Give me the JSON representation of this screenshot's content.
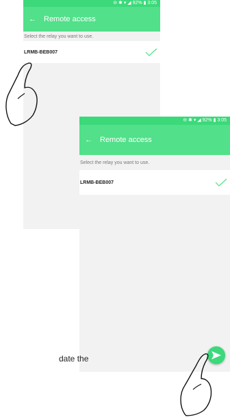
{
  "status_bar": {
    "text": "⊖ ✱ ▾ ◢ 92% ▮ 3:05",
    "time": "3:05",
    "battery": "92%"
  },
  "app": {
    "title": "Remote access",
    "back_icon": "arrow-left-icon"
  },
  "instruction": "Select the relay you want to use.",
  "relays": [
    {
      "name": "LRMB-BEB007",
      "selected": true
    }
  ],
  "fab_icon": "send-arrow-icon",
  "caption_fragment": "date the",
  "colors": {
    "status_bar": "#3bd97a",
    "app_bar": "#52e08a",
    "check": "#52e08a",
    "background": "#f2f2f2"
  }
}
